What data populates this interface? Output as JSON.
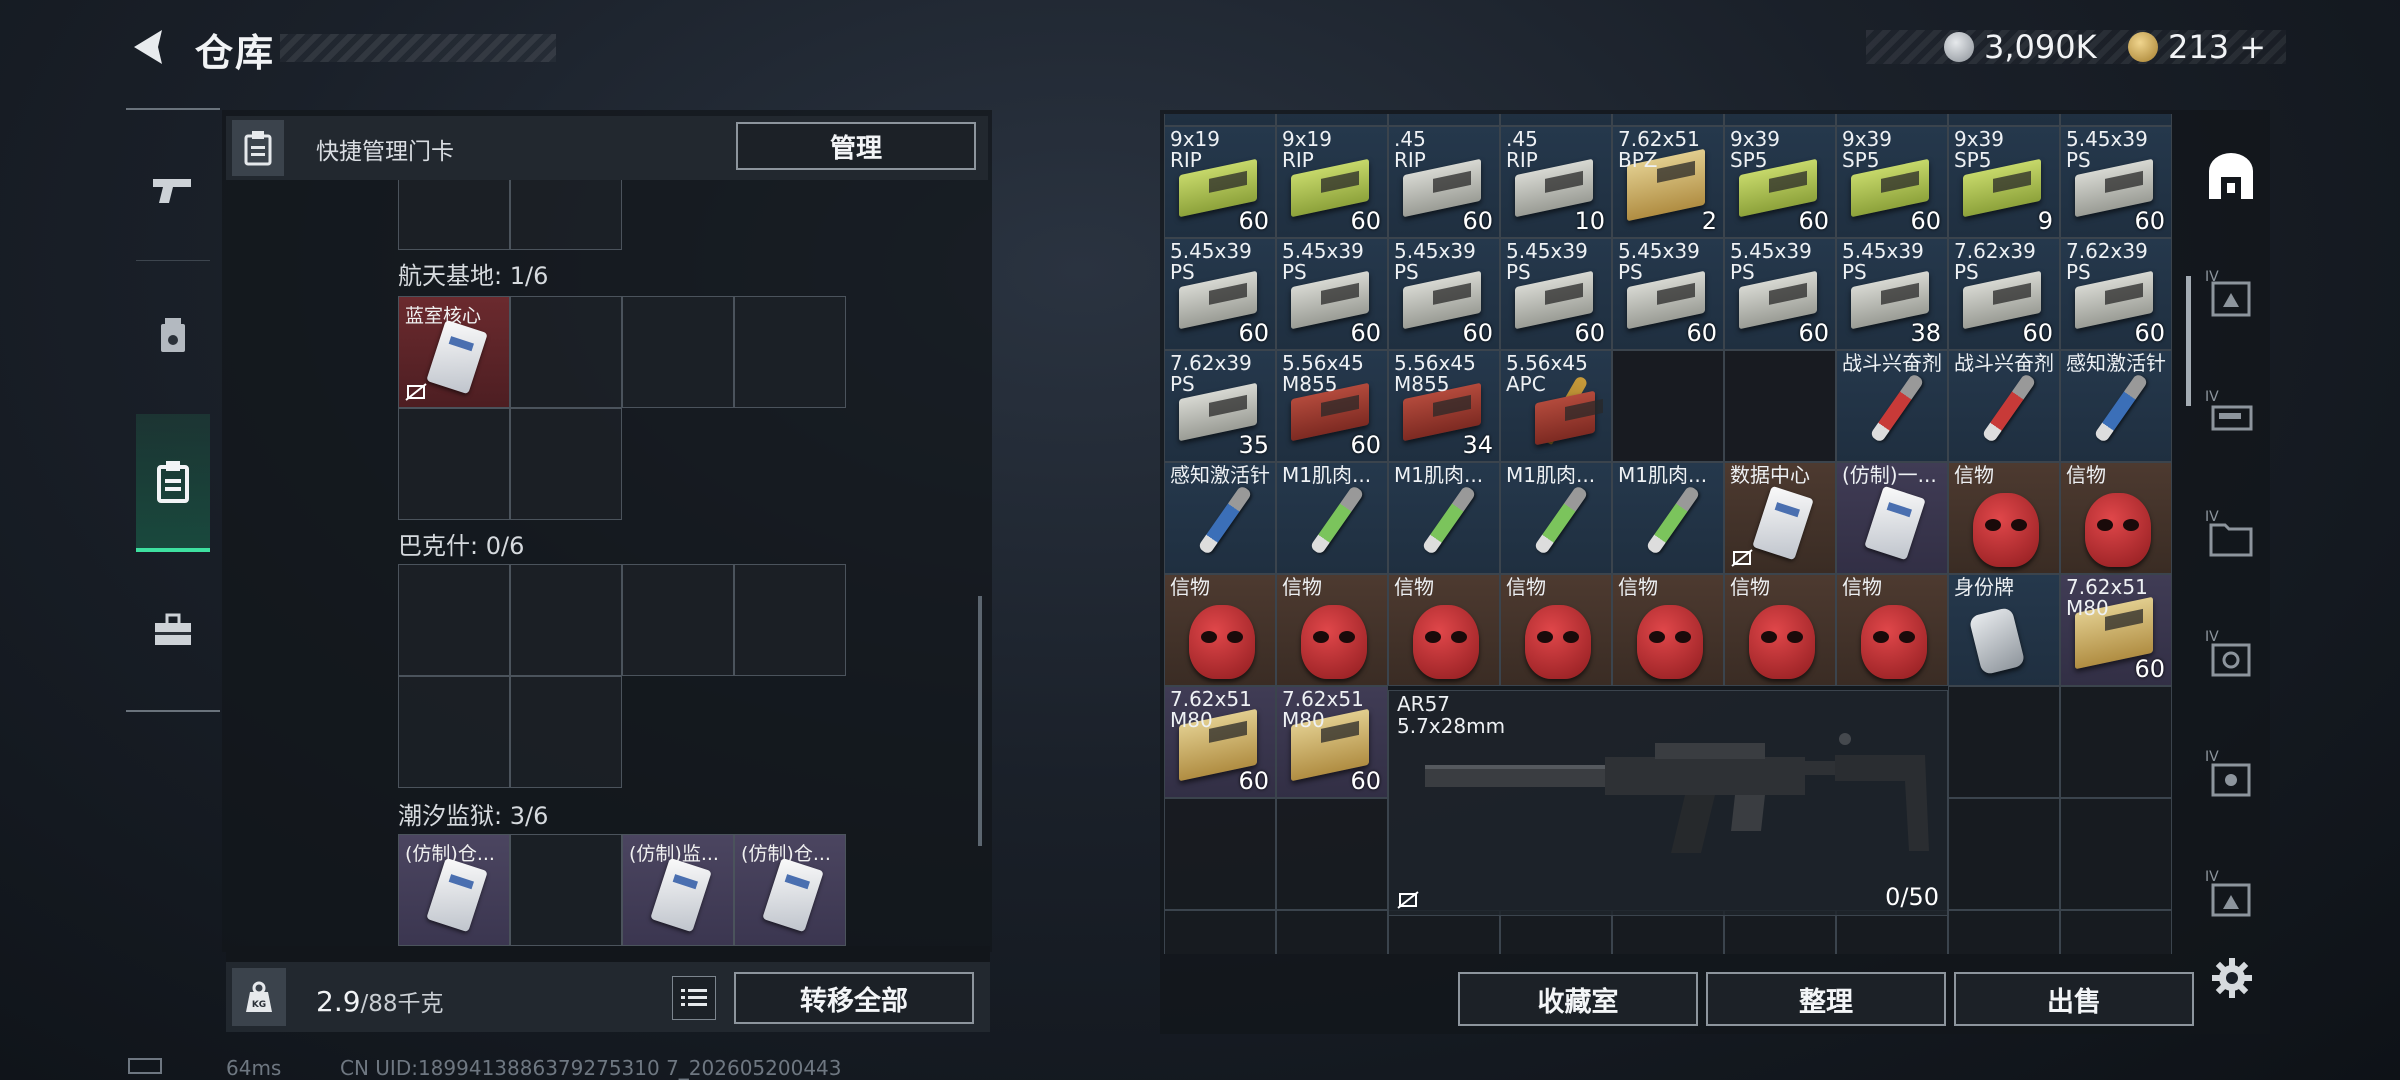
{
  "header": {
    "title": "仓库",
    "currency_primary": "3,090K",
    "currency_secondary": "213",
    "currency_add": "+"
  },
  "left_nav": [
    "weapons",
    "cards",
    "keycard-storage",
    "toolbox"
  ],
  "keycard_panel": {
    "title": "快捷管理门卡",
    "manage_button": "管理",
    "sections": [
      {
        "label": "航天基地: 1/6",
        "cards": [
          {
            "name": "蓝室核心",
            "rarity": "red"
          }
        ]
      },
      {
        "label": "巴克什: 0/6",
        "cards": []
      },
      {
        "label": "潮汐监狱: 3/6",
        "cards": [
          {
            "name": "(仿制)仓...",
            "rarity": "purple"
          },
          {
            "name": "(仿制)监...",
            "rarity": "purple"
          },
          {
            "name": "(仿制)仓...",
            "rarity": "purple"
          }
        ]
      }
    ]
  },
  "weight": {
    "current": "2.9",
    "max": "/88千克"
  },
  "transfer_button": "转移全部",
  "grid_rows": [
    [
      {
        "name": "9x19\nRIP",
        "count": "60",
        "icon": "ammo-box-green",
        "bg": "blue"
      },
      {
        "name": "9x19\nRIP",
        "count": "60",
        "icon": "ammo-box-green",
        "bg": "blue"
      },
      {
        "name": ".45\nRIP",
        "count": "60",
        "icon": "ammo-box-gray",
        "bg": "blue"
      },
      {
        "name": ".45\nRIP",
        "count": "10",
        "icon": "ammo-box-gray",
        "bg": "blue"
      },
      {
        "name": "7.62x51\nBPZ",
        "count": "2",
        "icon": "ammo-box-tan",
        "bg": "blue"
      },
      {
        "name": "9x39\nSP5",
        "count": "60",
        "icon": "ammo-box-green",
        "bg": "blue"
      },
      {
        "name": "9x39\nSP5",
        "count": "60",
        "icon": "ammo-box-green",
        "bg": "blue"
      },
      {
        "name": "9x39\nSP5",
        "count": "9",
        "icon": "ammo-box-green",
        "bg": "blue"
      },
      {
        "name": "5.45x39\nPS",
        "count": "60",
        "icon": "ammo-box-gray",
        "bg": "blue"
      }
    ],
    [
      {
        "name": "5.45x39\nPS",
        "count": "60",
        "icon": "ammo-box-gray",
        "bg": "blue"
      },
      {
        "name": "5.45x39\nPS",
        "count": "60",
        "icon": "ammo-box-gray",
        "bg": "blue"
      },
      {
        "name": "5.45x39\nPS",
        "count": "60",
        "icon": "ammo-box-gray",
        "bg": "blue"
      },
      {
        "name": "5.45x39\nPS",
        "count": "60",
        "icon": "ammo-box-gray",
        "bg": "blue"
      },
      {
        "name": "5.45x39\nPS",
        "count": "60",
        "icon": "ammo-box-gray",
        "bg": "blue"
      },
      {
        "name": "5.45x39\nPS",
        "count": "60",
        "icon": "ammo-box-gray",
        "bg": "blue"
      },
      {
        "name": "5.45x39\nPS",
        "count": "38",
        "icon": "ammo-box-gray",
        "bg": "blue"
      },
      {
        "name": "7.62x39\nPS",
        "count": "60",
        "icon": "ammo-box-gray",
        "bg": "blue"
      },
      {
        "name": "7.62x39\nPS",
        "count": "60",
        "icon": "ammo-box-gray",
        "bg": "blue"
      }
    ],
    [
      {
        "name": "7.62x39\nPS",
        "count": "35",
        "icon": "ammo-box-gray",
        "bg": "blue"
      },
      {
        "name": "5.56x45\nM855",
        "count": "60",
        "icon": "ammo-box-red",
        "bg": "blue"
      },
      {
        "name": "5.56x45\nM855",
        "count": "34",
        "icon": "ammo-box-red",
        "bg": "blue"
      },
      {
        "name": "5.56x45\nAPC",
        "count": "",
        "icon": "bullet",
        "bg": "blue"
      },
      {
        "name": "",
        "count": "",
        "icon": "",
        "bg": "empty"
      },
      {
        "name": "",
        "count": "",
        "icon": "",
        "bg": "empty"
      },
      {
        "name": "战斗兴奋剂",
        "count": "",
        "icon": "injector-red",
        "bg": "blue"
      },
      {
        "name": "战斗兴奋剂",
        "count": "",
        "icon": "injector-red",
        "bg": "blue"
      },
      {
        "name": "感知激活针",
        "count": "",
        "icon": "injector-blue",
        "bg": "blue"
      }
    ],
    [
      {
        "name": "感知激活针",
        "count": "",
        "icon": "injector-blue",
        "bg": "blue"
      },
      {
        "name": "M1肌肉...",
        "count": "",
        "icon": "injector-green",
        "bg": "blue"
      },
      {
        "name": "M1肌肉...",
        "count": "",
        "icon": "injector-green",
        "bg": "blue"
      },
      {
        "name": "M1肌肉...",
        "count": "",
        "icon": "injector-green",
        "bg": "blue"
      },
      {
        "name": "M1肌肉...",
        "count": "",
        "icon": "injector-green",
        "bg": "blue"
      },
      {
        "name": "数据中心",
        "count": "",
        "icon": "keycard",
        "bg": "brown"
      },
      {
        "name": "(仿制)一...",
        "count": "",
        "icon": "keycard",
        "bg": "purple"
      },
      {
        "name": "信物",
        "count": "",
        "icon": "red-mask",
        "bg": "brown"
      },
      {
        "name": "信物",
        "count": "",
        "icon": "red-mask",
        "bg": "brown"
      }
    ],
    [
      {
        "name": "信物",
        "count": "",
        "icon": "red-mask",
        "bg": "brown"
      },
      {
        "name": "信物",
        "count": "",
        "icon": "red-mask",
        "bg": "brown"
      },
      {
        "name": "信物",
        "count": "",
        "icon": "red-mask",
        "bg": "brown"
      },
      {
        "name": "信物",
        "count": "",
        "icon": "red-mask",
        "bg": "brown"
      },
      {
        "name": "信物",
        "count": "",
        "icon": "red-mask",
        "bg": "brown"
      },
      {
        "name": "信物",
        "count": "",
        "icon": "red-mask",
        "bg": "brown"
      },
      {
        "name": "信物",
        "count": "",
        "icon": "red-mask",
        "bg": "brown"
      },
      {
        "name": "身份牌",
        "count": "",
        "icon": "dog-tag",
        "bg": "blue"
      },
      {
        "name": "7.62x51\nM80",
        "count": "60",
        "icon": "ammo-box-tan",
        "bg": "purple"
      }
    ],
    [
      {
        "name": "7.62x51\nM80",
        "count": "60",
        "icon": "ammo-box-tan",
        "bg": "purple"
      },
      {
        "name": "7.62x51\nM80",
        "count": "60",
        "icon": "ammo-box-tan",
        "bg": "purple"
      }
    ]
  ],
  "weapon": {
    "name": "AR57",
    "caliber": "5.7x28mm",
    "ammo": "0/50"
  },
  "bottom_buttons": {
    "collection": "收藏室",
    "organize": "整理",
    "sell": "出售"
  },
  "right_nav_labels": [
    "IV",
    "IV",
    "IV",
    "IV",
    "IV",
    "IV"
  ],
  "status_bar": {
    "ping": "64ms",
    "uid": "CN UID:1899413886379275310 7_202605200443"
  },
  "colors": {
    "accent": "#3ee0a0"
  }
}
